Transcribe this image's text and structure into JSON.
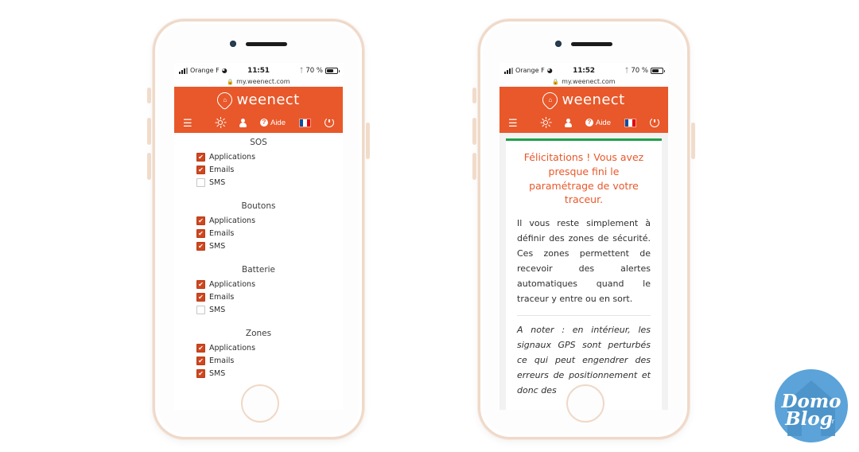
{
  "brand": {
    "name": "weenect",
    "accent_color": "#E8582A",
    "checkbox_color": "#D0461E",
    "card_accent_color": "#20A14C"
  },
  "phones": [
    {
      "id": "left",
      "status_bar": {
        "carrier": "Orange F",
        "time": "11:51",
        "battery_percent": "70 %",
        "wifi_icon": "wifi-icon",
        "bluetooth_icon": "bluetooth-icon",
        "signal_icon": "signal-bars-icon"
      },
      "url_bar": {
        "lock_icon": "lock-icon",
        "url": "my.weenect.com"
      },
      "appbar": {
        "logo_label": "weenect",
        "menu_icon": "hamburger-menu-icon",
        "brightness_icon": "sun-icon",
        "account_icon": "person-icon",
        "help_label": "Aide",
        "help_icon": "question-mark-icon",
        "language_icon": "french-flag-icon",
        "logout_icon": "power-icon"
      },
      "screen_type": "notification-settings",
      "groups": [
        {
          "title": "SOS",
          "options": [
            {
              "label": "Applications",
              "checked": true
            },
            {
              "label": "Emails",
              "checked": true
            },
            {
              "label": "SMS",
              "checked": false
            }
          ]
        },
        {
          "title": "Boutons",
          "options": [
            {
              "label": "Applications",
              "checked": true
            },
            {
              "label": "Emails",
              "checked": true
            },
            {
              "label": "SMS",
              "checked": true
            }
          ]
        },
        {
          "title": "Batterie",
          "options": [
            {
              "label": "Applications",
              "checked": true
            },
            {
              "label": "Emails",
              "checked": true
            },
            {
              "label": "SMS",
              "checked": false
            }
          ]
        },
        {
          "title": "Zones",
          "options": [
            {
              "label": "Applications",
              "checked": true
            },
            {
              "label": "Emails",
              "checked": true
            },
            {
              "label": "SMS",
              "checked": true
            }
          ]
        }
      ]
    },
    {
      "id": "right",
      "status_bar": {
        "carrier": "Orange F",
        "time": "11:52",
        "battery_percent": "70 %",
        "wifi_icon": "wifi-icon",
        "bluetooth_icon": "bluetooth-icon",
        "signal_icon": "signal-bars-icon"
      },
      "url_bar": {
        "lock_icon": "lock-icon",
        "url": "my.weenect.com"
      },
      "appbar": {
        "logo_label": "weenect",
        "menu_icon": "hamburger-menu-icon",
        "brightness_icon": "sun-icon",
        "account_icon": "person-icon",
        "help_label": "Aide",
        "help_icon": "question-mark-icon",
        "language_icon": "french-flag-icon",
        "logout_icon": "power-icon"
      },
      "screen_type": "congratulations-card",
      "card": {
        "title": "Félicitations ! Vous avez presque fini le paramétrage de votre traceur.",
        "body": "Il vous reste simplement à définir des zones de sécurité. Ces zones permettent de recevoir des alertes automatiques quand le traceur y entre ou en sort.",
        "note": "A noter : en intérieur, les signaux GPS sont perturbés ce qui peut engendrer des erreurs de positionnement et donc des"
      }
    }
  ],
  "watermark": {
    "line1": "Domo",
    "line2": "Blog",
    "suffix": "fr",
    "color": "#5BA3D8"
  }
}
